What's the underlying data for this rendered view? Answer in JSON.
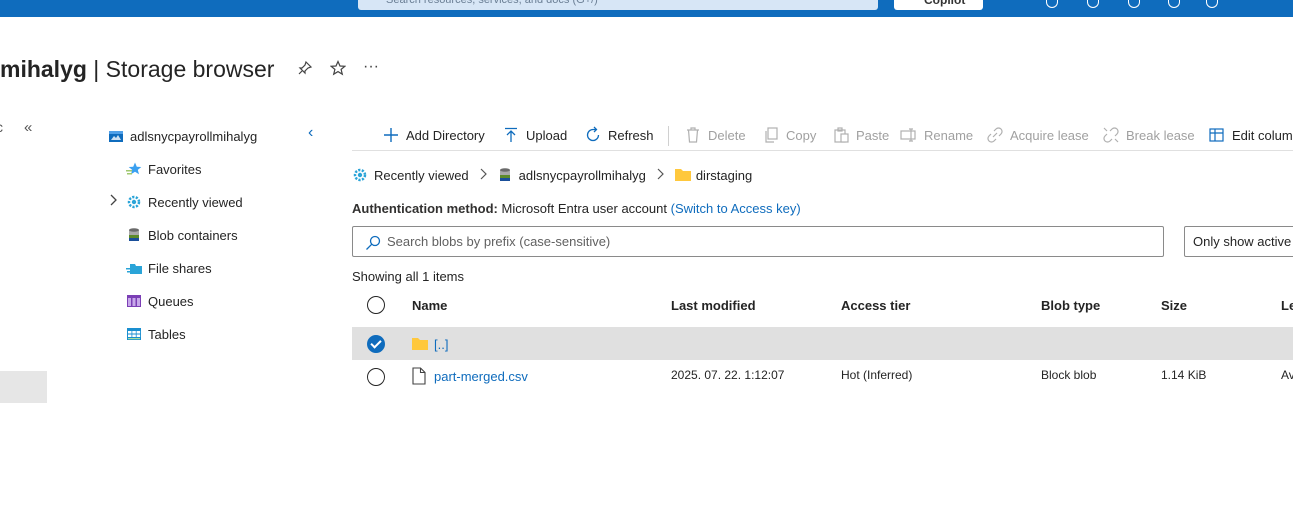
{
  "topbar": {
    "search_placeholder": "Search resources, services, and docs (G+/)",
    "copilot_label": "Copilot"
  },
  "header": {
    "title_bold": "mihalyg",
    "title_rest": " | Storage browser",
    "pin_icon": "pin-icon",
    "favorite_icon": "star-icon",
    "more_label": "···"
  },
  "left_panel": {
    "collapse_label": "«",
    "tree_collapse_label": "‹"
  },
  "tree": {
    "root_label": "adlsnycpayrollmihalyg",
    "items": [
      {
        "label": "Favorites",
        "icon": "favorites-icon"
      },
      {
        "label": "Recently viewed",
        "icon": "recently-viewed-icon",
        "expandable": true
      },
      {
        "label": "Blob containers",
        "icon": "blob-containers-icon"
      },
      {
        "label": "File shares",
        "icon": "file-shares-icon"
      },
      {
        "label": "Queues",
        "icon": "queues-icon"
      },
      {
        "label": "Tables",
        "icon": "tables-icon"
      }
    ]
  },
  "toolbar": {
    "add_directory": "Add Directory",
    "upload": "Upload",
    "refresh": "Refresh",
    "delete": "Delete",
    "copy": "Copy",
    "paste": "Paste",
    "rename": "Rename",
    "acquire_lease": "Acquire lease",
    "break_lease": "Break lease",
    "edit_columns": "Edit columns"
  },
  "breadcrumb": {
    "items": [
      "Recently viewed",
      "adlsnycpayrollmihalyg",
      "dirstaging"
    ]
  },
  "auth": {
    "label": "Authentication method:",
    "value": "Microsoft Entra user account",
    "switch_link": "(Switch to Access key)"
  },
  "search": {
    "placeholder": "Search blobs by prefix (case-sensitive)"
  },
  "filter": {
    "value": "Only show active blobs"
  },
  "status": {
    "showing": "Showing all 1 items"
  },
  "table": {
    "columns": [
      "Name",
      "Last modified",
      "Access tier",
      "Blob type",
      "Size",
      "Le"
    ],
    "rows": [
      {
        "name": "[..]",
        "type": "folder",
        "selected": true,
        "last_modified": "",
        "access_tier": "",
        "blob_type": "",
        "size": "",
        "lease": ""
      },
      {
        "name": "part-merged.csv",
        "type": "file",
        "selected": false,
        "last_modified": "2025. 07. 22. 1:12:07",
        "access_tier": "Hot (Inferred)",
        "blob_type": "Block blob",
        "size": "1.14 KiB",
        "lease": "Av"
      }
    ]
  },
  "colors": {
    "accent": "#0f6cbd",
    "selected_row": "#e0e0e0",
    "folder": "#ffc83d"
  }
}
